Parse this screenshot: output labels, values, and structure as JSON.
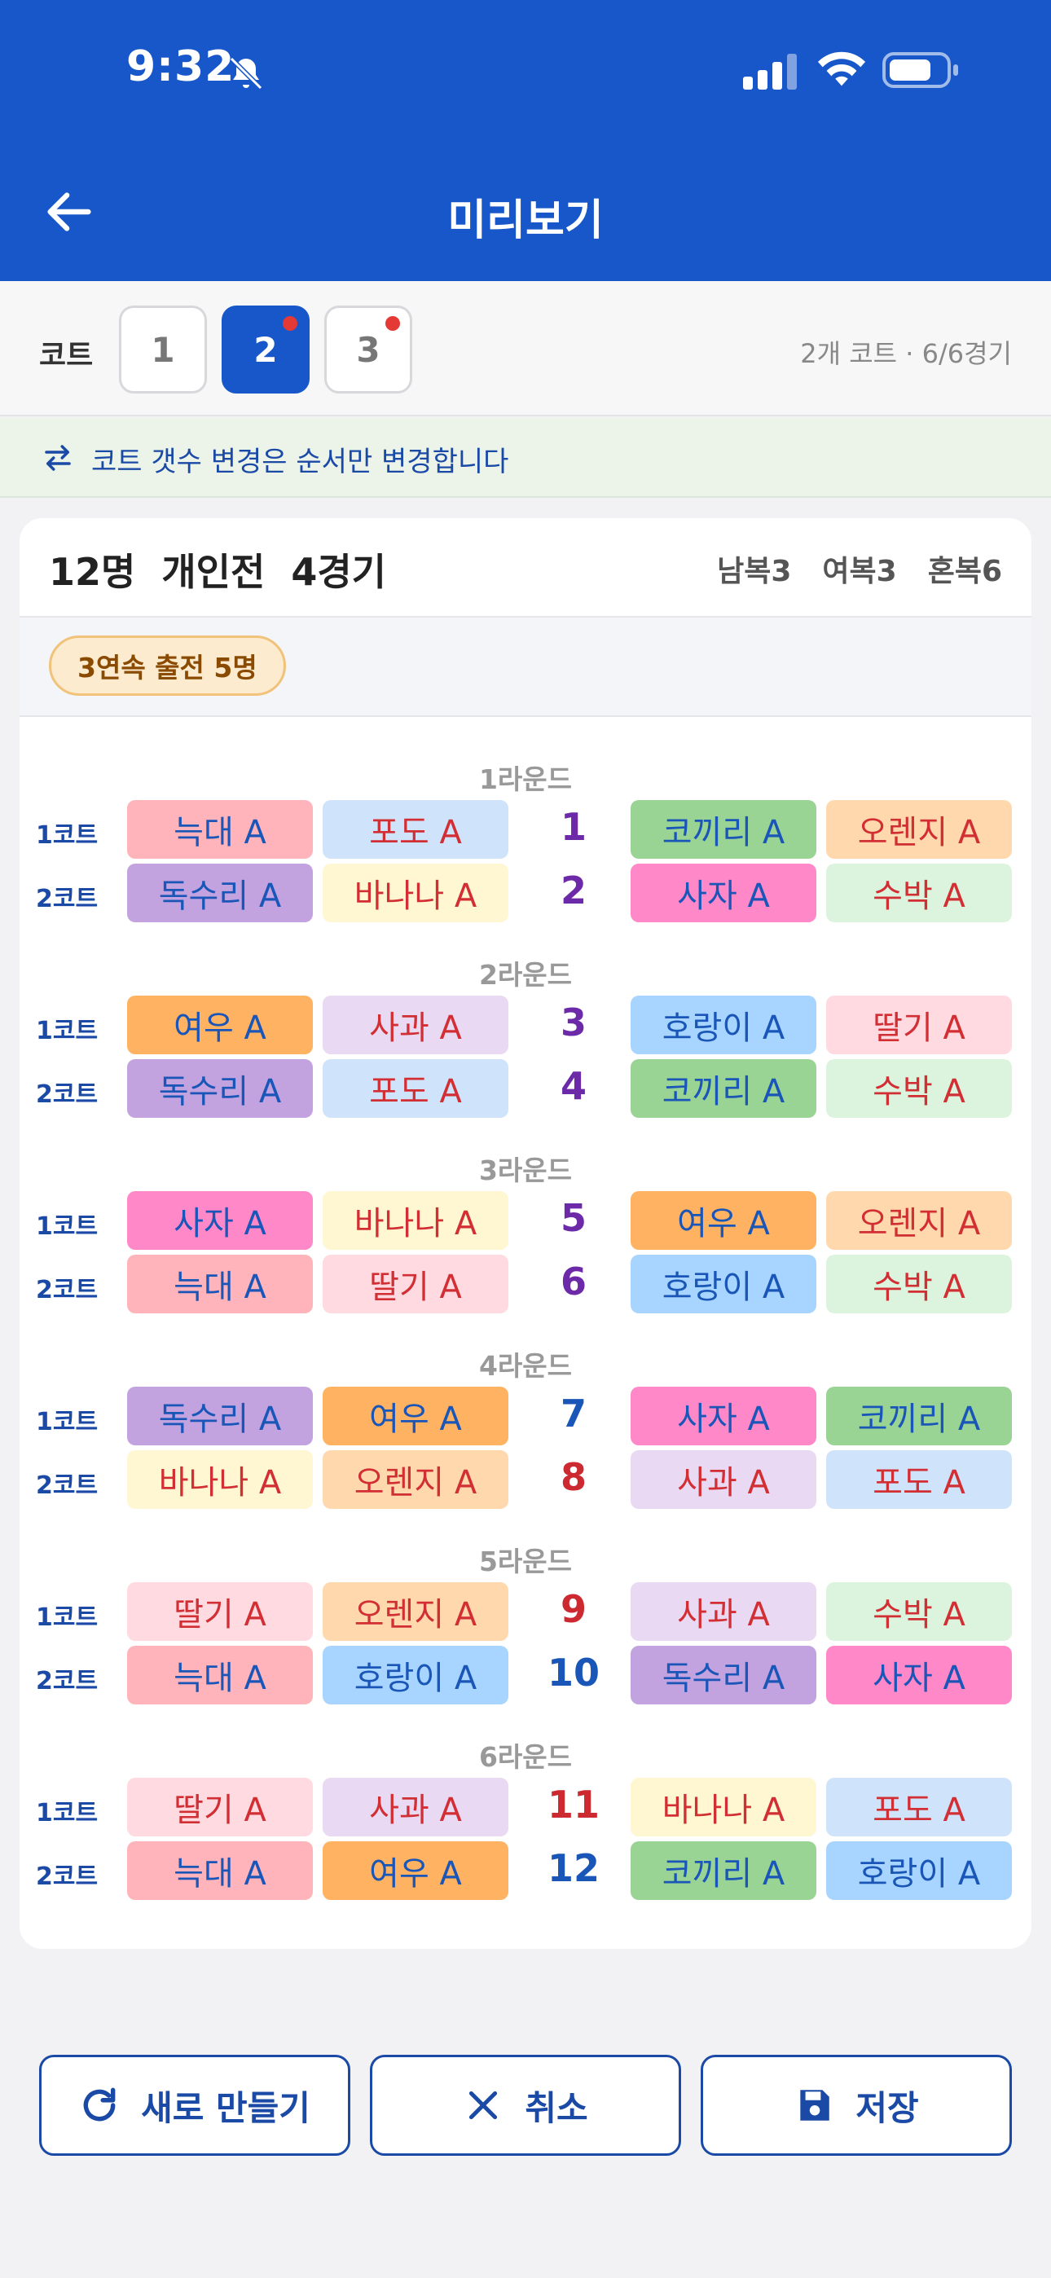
{
  "status": {
    "time": "9:32"
  },
  "header": {
    "title": "미리보기"
  },
  "court_bar": {
    "label": "코트",
    "courts": [
      {
        "label": "1",
        "active": false,
        "dot": false
      },
      {
        "label": "2",
        "active": true,
        "dot": true
      },
      {
        "label": "3",
        "active": false,
        "dot": true
      }
    ],
    "summary": "2개 코트 · 6/6경기"
  },
  "notice": {
    "text": "코트 갯수 변경은 순서만 변경합니다"
  },
  "card": {
    "title": "12명  개인전  4경기",
    "stats": [
      "남복3",
      "여복3",
      "혼복6"
    ],
    "badge": "3연속 출전 5명"
  },
  "colors": {
    "늑대": "#ffb3bb",
    "포도": "#cfe4fb",
    "코끼리": "#9ad495",
    "오렌지": "#ffd9ad",
    "독수리": "#c2a3e0",
    "바나나": "#fff7d1",
    "사자": "#ff88c8",
    "수박": "#dcf4dd",
    "여우": "#ffb261",
    "사과": "#ead9f2",
    "호랑이": "#a8d5ff",
    "딸기": "#ffdbe1",
    "blue_text": "#1a56b8",
    "red_text": "#d22f35",
    "game_purple": "#6c2aa8",
    "game_blue": "#1a56b8",
    "game_red": "#cc2a30"
  },
  "rounds": [
    {
      "title": "1라운드",
      "matches": [
        {
          "court": "1코트",
          "no": "1",
          "no_color": "purple",
          "team1": [
            [
              "늑대 A",
              "blue"
            ],
            [
              "포도 A",
              "red"
            ]
          ],
          "team2": [
            [
              "코끼리 A",
              "blue"
            ],
            [
              "오렌지 A",
              "red"
            ]
          ]
        },
        {
          "court": "2코트",
          "no": "2",
          "no_color": "purple",
          "team1": [
            [
              "독수리 A",
              "blue"
            ],
            [
              "바나나 A",
              "red"
            ]
          ],
          "team2": [
            [
              "사자 A",
              "blue"
            ],
            [
              "수박 A",
              "red"
            ]
          ]
        }
      ]
    },
    {
      "title": "2라운드",
      "matches": [
        {
          "court": "1코트",
          "no": "3",
          "no_color": "purple",
          "team1": [
            [
              "여우 A",
              "blue"
            ],
            [
              "사과 A",
              "red"
            ]
          ],
          "team2": [
            [
              "호랑이 A",
              "blue"
            ],
            [
              "딸기 A",
              "red"
            ]
          ]
        },
        {
          "court": "2코트",
          "no": "4",
          "no_color": "purple",
          "team1": [
            [
              "독수리 A",
              "blue"
            ],
            [
              "포도 A",
              "red"
            ]
          ],
          "team2": [
            [
              "코끼리 A",
              "blue"
            ],
            [
              "수박 A",
              "red"
            ]
          ]
        }
      ]
    },
    {
      "title": "3라운드",
      "matches": [
        {
          "court": "1코트",
          "no": "5",
          "no_color": "purple",
          "team1": [
            [
              "사자 A",
              "blue"
            ],
            [
              "바나나 A",
              "red"
            ]
          ],
          "team2": [
            [
              "여우 A",
              "blue"
            ],
            [
              "오렌지 A",
              "red"
            ]
          ]
        },
        {
          "court": "2코트",
          "no": "6",
          "no_color": "purple",
          "team1": [
            [
              "늑대 A",
              "blue"
            ],
            [
              "딸기 A",
              "red"
            ]
          ],
          "team2": [
            [
              "호랑이 A",
              "blue"
            ],
            [
              "수박 A",
              "red"
            ]
          ]
        }
      ]
    },
    {
      "title": "4라운드",
      "matches": [
        {
          "court": "1코트",
          "no": "7",
          "no_color": "blue",
          "team1": [
            [
              "독수리 A",
              "blue"
            ],
            [
              "여우 A",
              "blue"
            ]
          ],
          "team2": [
            [
              "사자 A",
              "blue"
            ],
            [
              "코끼리 A",
              "blue"
            ]
          ]
        },
        {
          "court": "2코트",
          "no": "8",
          "no_color": "red",
          "team1": [
            [
              "바나나 A",
              "red"
            ],
            [
              "오렌지 A",
              "red"
            ]
          ],
          "team2": [
            [
              "사과 A",
              "red"
            ],
            [
              "포도 A",
              "red"
            ]
          ]
        }
      ]
    },
    {
      "title": "5라운드",
      "matches": [
        {
          "court": "1코트",
          "no": "9",
          "no_color": "red",
          "team1": [
            [
              "딸기 A",
              "red"
            ],
            [
              "오렌지 A",
              "red"
            ]
          ],
          "team2": [
            [
              "사과 A",
              "red"
            ],
            [
              "수박 A",
              "red"
            ]
          ]
        },
        {
          "court": "2코트",
          "no": "10",
          "no_color": "blue",
          "team1": [
            [
              "늑대 A",
              "blue"
            ],
            [
              "호랑이 A",
              "blue"
            ]
          ],
          "team2": [
            [
              "독수리 A",
              "blue"
            ],
            [
              "사자 A",
              "blue"
            ]
          ]
        }
      ]
    },
    {
      "title": "6라운드",
      "matches": [
        {
          "court": "1코트",
          "no": "11",
          "no_color": "red",
          "team1": [
            [
              "딸기 A",
              "red"
            ],
            [
              "사과 A",
              "red"
            ]
          ],
          "team2": [
            [
              "바나나 A",
              "red"
            ],
            [
              "포도 A",
              "red"
            ]
          ]
        },
        {
          "court": "2코트",
          "no": "12",
          "no_color": "blue",
          "team1": [
            [
              "늑대 A",
              "blue"
            ],
            [
              "여우 A",
              "blue"
            ]
          ],
          "team2": [
            [
              "코끼리 A",
              "blue"
            ],
            [
              "호랑이 A",
              "blue"
            ]
          ]
        }
      ]
    }
  ],
  "actions": {
    "regenerate": "새로 만들기",
    "cancel": "취소",
    "save": "저장"
  },
  "icons": [
    "bell-off-icon",
    "signal-icon",
    "wifi-icon",
    "battery-icon",
    "back-arrow-icon",
    "swap-icon",
    "refresh-icon",
    "close-icon",
    "save-icon"
  ]
}
